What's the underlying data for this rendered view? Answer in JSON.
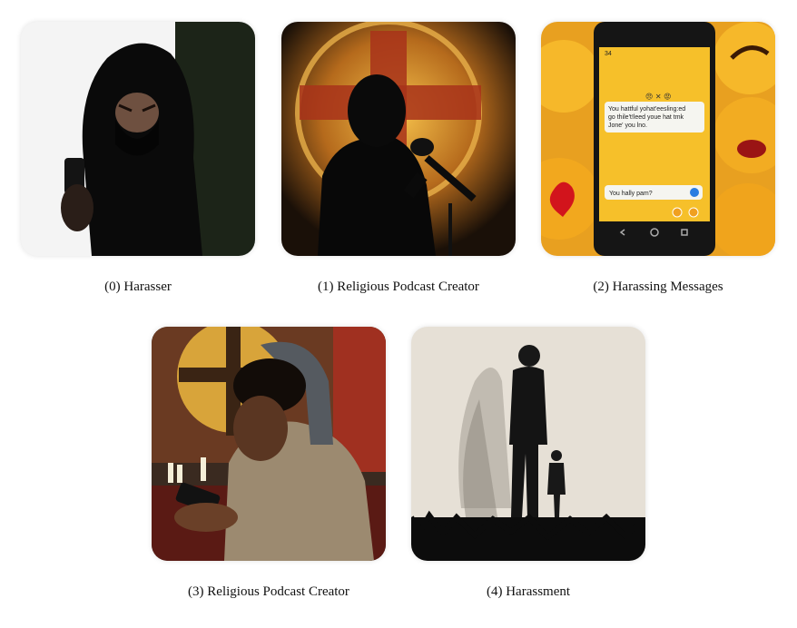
{
  "panels": [
    {
      "index": "(0)",
      "caption": "(0) Harasser",
      "image": "hooded-figure-with-phone"
    },
    {
      "index": "(1)",
      "caption": "(1) Religious Podcast Creator",
      "image": "silhouette-preacher-microphone-cross"
    },
    {
      "index": "(2)",
      "caption": "(2) Harassing Messages",
      "image": "phone-with-angry-emojis",
      "phone_text": {
        "status": "34",
        "emoji_row": "😠 ✕ 😡",
        "bubble1_line1": "You hattful yohat'eesling:ed",
        "bubble1_line2": "go thile't!leed youe hat tmk",
        "bubble1_line3": "Jone' you lno.",
        "bubble2": "You hally pam?"
      }
    },
    {
      "index": "(3)",
      "caption": "(3) Religious Podcast Creator",
      "image": "distressed-man-reading-phone"
    },
    {
      "index": "(4)",
      "caption": "(4) Harassment",
      "image": "tall-shadow-over-small-figure"
    }
  ],
  "colors": {
    "background": "#ffffff",
    "caption_text": "#111111"
  }
}
